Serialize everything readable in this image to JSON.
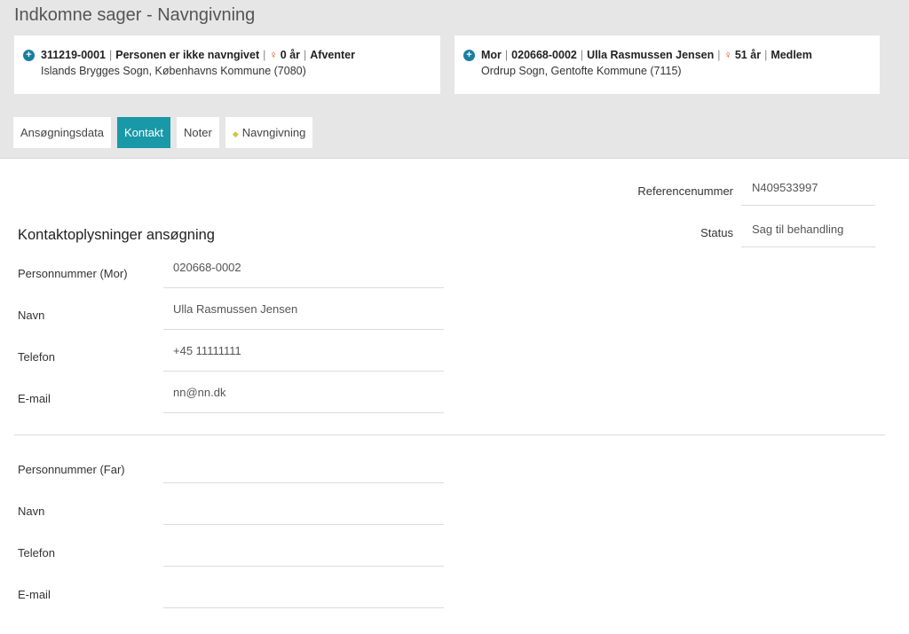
{
  "page": {
    "title": "Indkomne sager - Navngivning"
  },
  "child_card": {
    "cpr": "311219-",
    "cpr_bold": "0001",
    "status_text": "Personen er ikke navngivet",
    "age": "0 år",
    "membership": "Afventer",
    "location": "Islands Brygges Sogn, Københavns Kommune (7080)",
    "gender_icon": "female-icon"
  },
  "mother_card": {
    "role": "Mor",
    "cpr": "020668-",
    "cpr_bold": "0002",
    "name": "Ulla Rasmussen Jensen",
    "age": "51 år",
    "membership": "Medlem",
    "location": "Ordrup Sogn, Gentofte Kommune (7115)",
    "gender_icon": "female-icon"
  },
  "tabs": [
    {
      "label": "Ansøgningsdata"
    },
    {
      "label": "Kontakt"
    },
    {
      "label": "Noter"
    },
    {
      "label": "Navngivning"
    }
  ],
  "meta": {
    "reference_label": "Referencenummer",
    "reference_value": "N409533997",
    "status_label": "Status",
    "status_value": "Sag til behandling"
  },
  "section": {
    "title": "Kontaktoplysninger ansøgning"
  },
  "mother_contact": {
    "cpr_label": "Personnummer (Mor)",
    "cpr_value": "020668-0002",
    "name_label": "Navn",
    "name_value": "Ulla Rasmussen Jensen",
    "phone_label": "Telefon",
    "phone_value": "+45 11111111",
    "email_label": "E-mail",
    "email_value": "nn@nn.dk"
  },
  "father_contact": {
    "cpr_label": "Personnummer (Far)",
    "cpr_value": "",
    "name_label": "Navn",
    "name_value": "",
    "phone_label": "Telefon",
    "phone_value": "",
    "email_label": "E-mail",
    "email_value": ""
  },
  "colors": {
    "accent": "#1998a7",
    "header_bg": "#e6e6e6",
    "icon_blue": "#1a7fa0",
    "female_orange": "#d9531e"
  }
}
